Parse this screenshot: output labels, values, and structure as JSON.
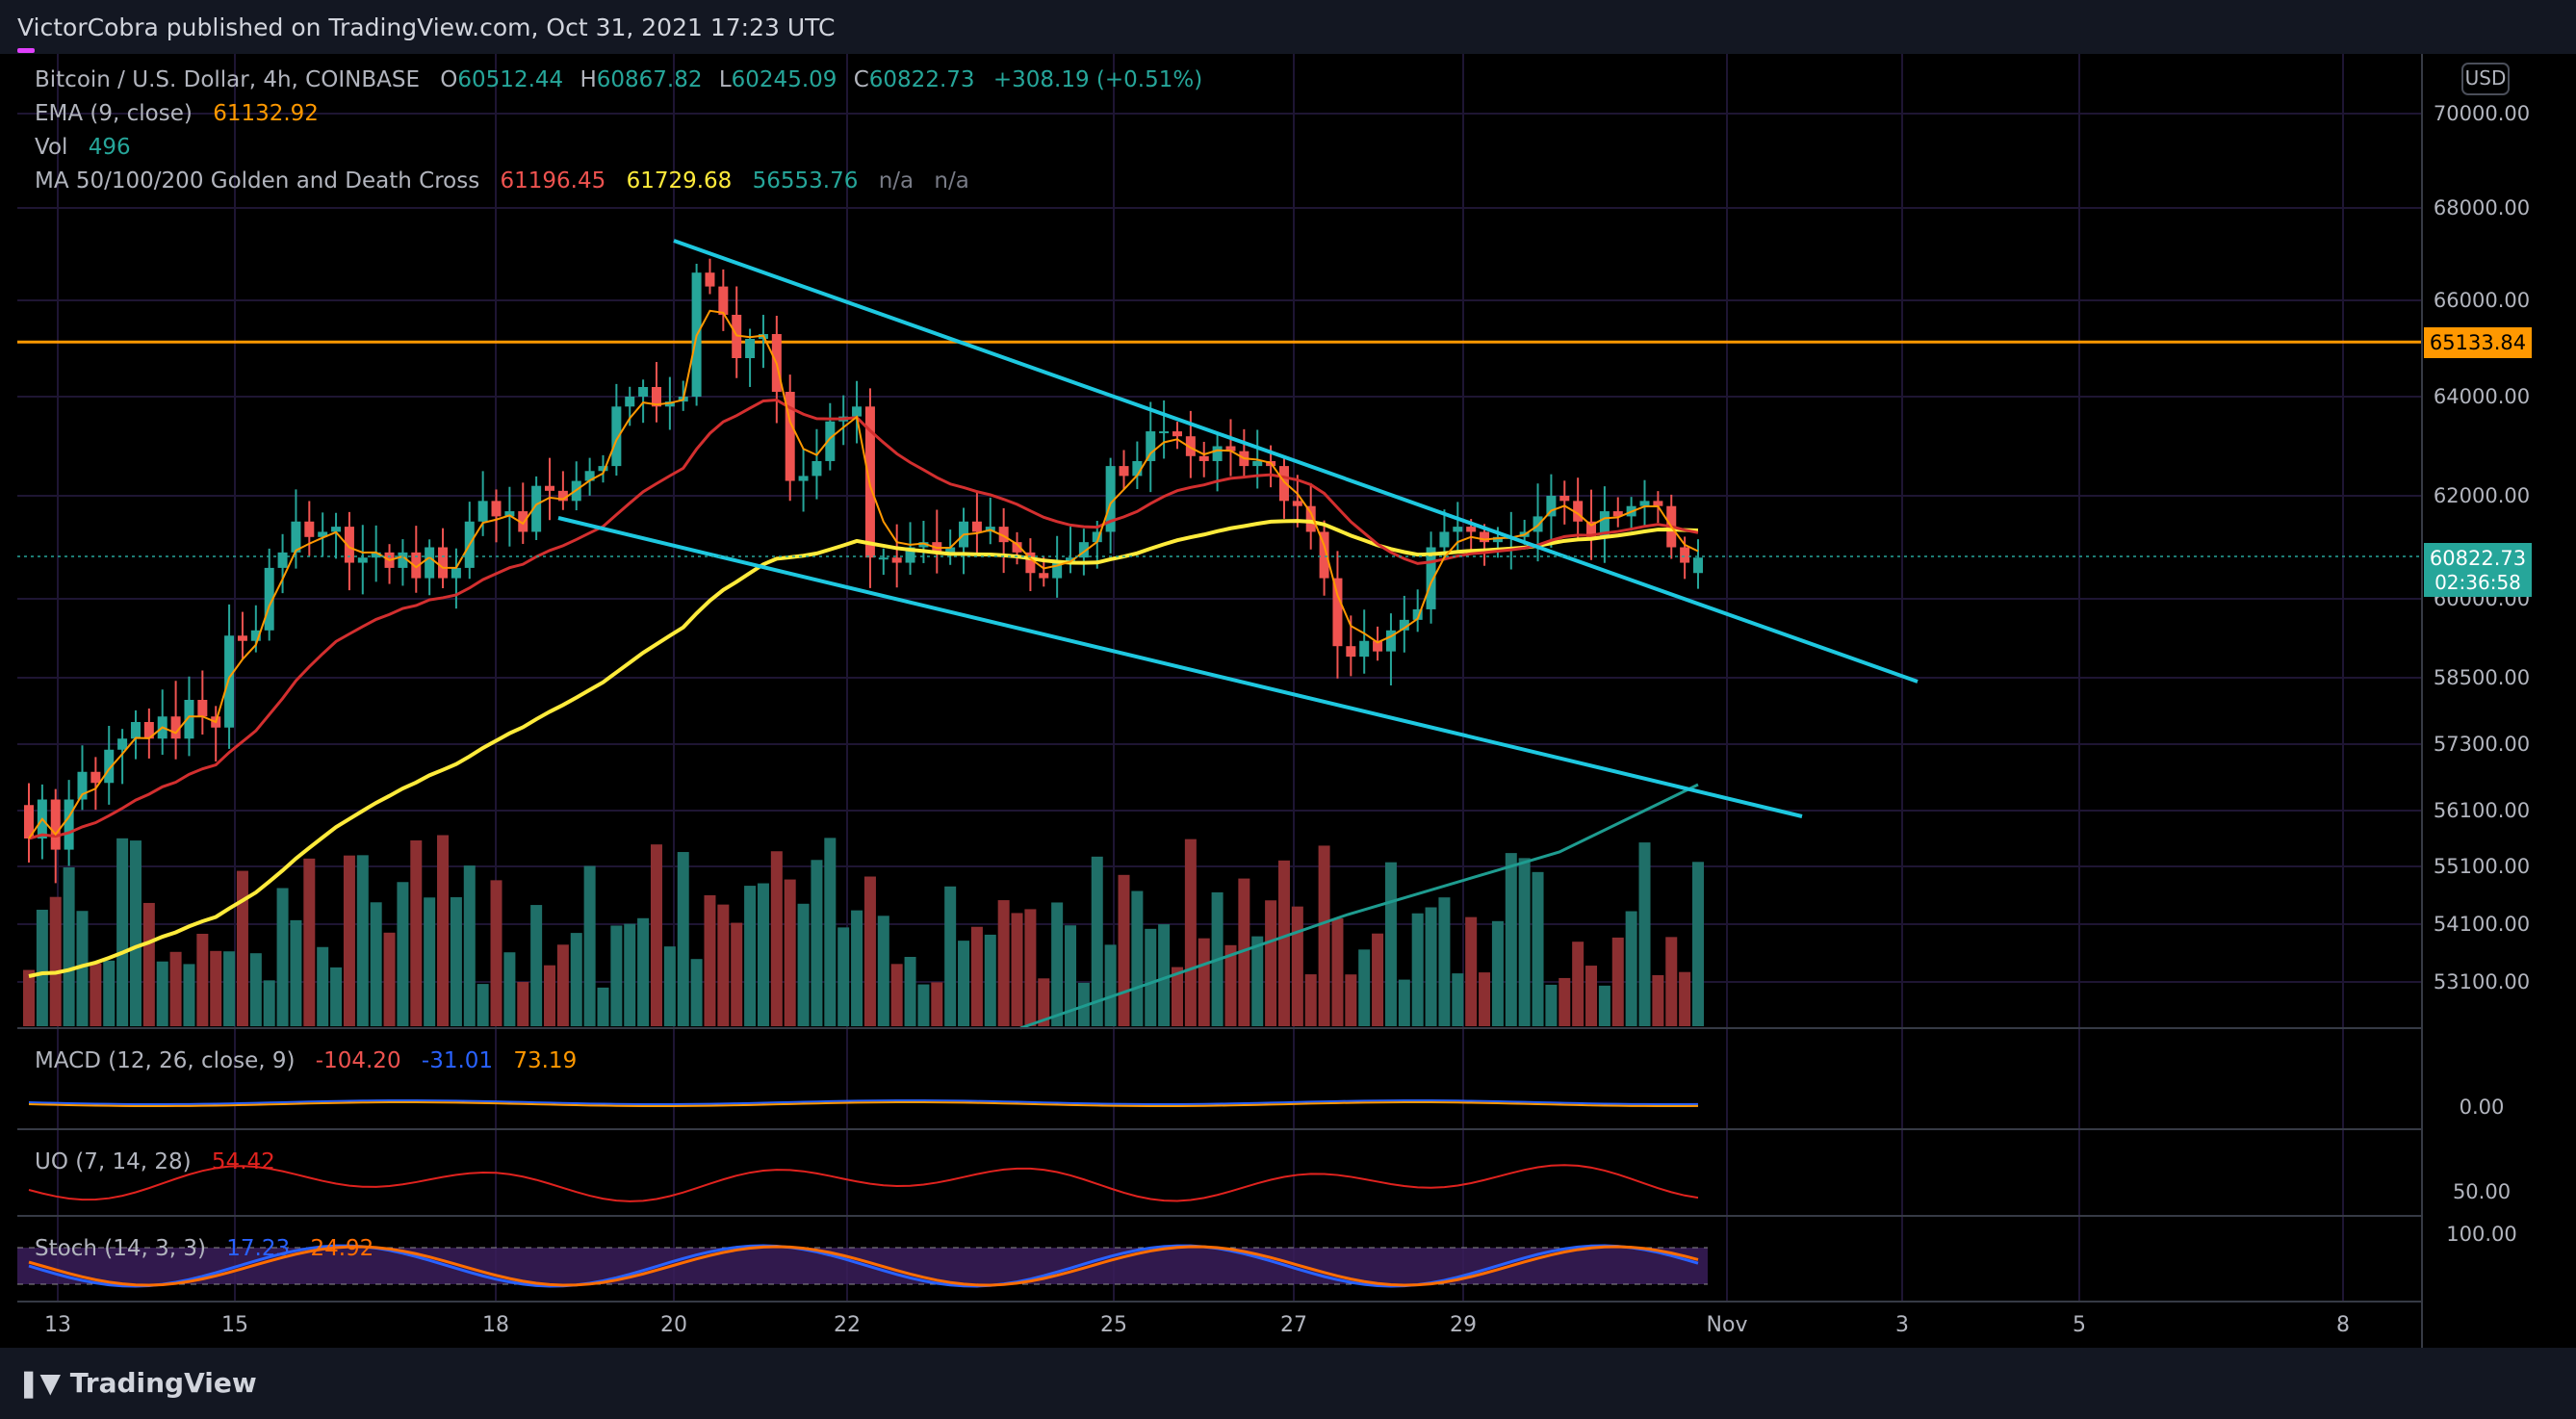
{
  "header": {
    "publisher": "VictorCobra published on TradingView.com, Oct 31, 2021 17:23 UTC"
  },
  "legend": {
    "symbol": "Bitcoin / U.S. Dollar, 4h, COINBASE",
    "o_label": "O",
    "o_value": "60512.44",
    "h_label": "H",
    "h_value": "60867.82",
    "l_label": "L",
    "l_value": "60245.09",
    "c_label": "C",
    "c_value": "60822.73",
    "change": "+308.19 (+0.51%)",
    "ema_label": "EMA (9, close)",
    "ema_value": "61132.92",
    "vol_label": "Vol",
    "vol_value": "496",
    "ma_label": "MA 50/100/200 Golden and Death Cross",
    "ma50_value": "61196.45",
    "ma100_value": "61729.68",
    "ma200_value": "56553.76",
    "na1": "n/a",
    "na2": "n/a"
  },
  "macd": {
    "label": "MACD (12, 26, close, 9)",
    "v1": "-104.20",
    "v2": "-31.01",
    "v3": "73.19"
  },
  "uo": {
    "label": "UO (7, 14, 28)",
    "v1": "54.42"
  },
  "stoch": {
    "label": "Stoch (14, 3, 3)",
    "v1": "17.23",
    "v2": "24.92"
  },
  "currency": "USD",
  "price_scale": [
    "70000.00",
    "68000.00",
    "66000.00",
    "64000.00",
    "62000.00",
    "60000.00",
    "58500.00",
    "57300.00",
    "56100.00",
    "55100.00",
    "54100.00",
    "53100.00"
  ],
  "macd_scale": [
    "0.00"
  ],
  "uo_scale": [
    "50.00"
  ],
  "stoch_scale": [
    "100.00"
  ],
  "hline_label": "65133.84",
  "last_price": {
    "price": "60822.73",
    "countdown": "02:36:58"
  },
  "x_axis": [
    "13",
    "15",
    "18",
    "20",
    "22",
    "25",
    "27",
    "29",
    "Nov",
    "3",
    "5",
    "8"
  ],
  "footer": {
    "brand": "TradingView"
  },
  "colors": {
    "background": "#131722",
    "up": "#26a69a",
    "down": "#ef5350",
    "ema": "#ff9800",
    "ma50": "#d32f2f",
    "ma100": "#ffeb3b",
    "ma200": "#1e9c90",
    "trendline": "#1ec8e0",
    "hline": "#ff9800",
    "grid": "#2a1f4e"
  },
  "chart_data": {
    "type": "candlestick",
    "title": "Bitcoin / U.S. Dollar, 4h, COINBASE",
    "ylim": [
      52300,
      71000
    ],
    "x": [
      "13",
      "15",
      "18",
      "20",
      "22",
      "25",
      "27",
      "29",
      "Nov",
      "3",
      "5",
      "8"
    ],
    "horizontal_line": 65133.84,
    "close": [
      55600,
      56300,
      55400,
      56300,
      56800,
      56600,
      57200,
      57400,
      57700,
      57400,
      57800,
      57400,
      58100,
      57800,
      57600,
      59300,
      59200,
      59400,
      60600,
      60900,
      61500,
      61200,
      61300,
      61400,
      60700,
      60800,
      60900,
      60600,
      60900,
      60400,
      61000,
      60400,
      60600,
      61500,
      61900,
      61600,
      61700,
      61300,
      62200,
      62100,
      61900,
      62300,
      62500,
      62600,
      63800,
      64000,
      64200,
      63800,
      63900,
      64000,
      66600,
      66300,
      65700,
      64800,
      65200,
      65300,
      64100,
      62300,
      62400,
      62700,
      63500,
      63600,
      63800,
      60800,
      60800,
      60700,
      61000,
      61100,
      60900,
      61000,
      61500,
      61300,
      61400,
      61100,
      60900,
      60500,
      60400,
      60700,
      60800,
      61100,
      61300,
      62600,
      62400,
      62700,
      63300,
      63300,
      63200,
      62800,
      62700,
      63000,
      62900,
      62600,
      62700,
      62600,
      61900,
      61800,
      61300,
      60400,
      59100,
      58900,
      59200,
      59000,
      59400,
      59600,
      59800,
      61000,
      61300,
      61400,
      61300,
      61100,
      61200,
      61200,
      61300,
      61600,
      62000,
      61900,
      61500,
      61200,
      61700,
      61600,
      61800,
      61900,
      61800,
      61000,
      60700,
      60800
    ],
    "open": [
      56200,
      55600,
      56300,
      55400,
      56300,
      56800,
      56600,
      57200,
      57400,
      57700,
      57400,
      57800,
      57400,
      58100,
      57800,
      57600,
      59300,
      59200,
      59400,
      60600,
      60900,
      61500,
      61200,
      61300,
      61400,
      60700,
      60800,
      60900,
      60600,
      60900,
      60400,
      61000,
      60400,
      60600,
      61500,
      61900,
      61600,
      61700,
      61300,
      62200,
      62100,
      61900,
      62300,
      62500,
      62600,
      63800,
      64000,
      64200,
      63800,
      63900,
      64000,
      66600,
      66300,
      65700,
      64800,
      65200,
      65300,
      64100,
      62300,
      62400,
      62700,
      63500,
      63600,
      63800,
      60800,
      60800,
      60700,
      61000,
      61100,
      60900,
      61000,
      61500,
      61300,
      61400,
      61100,
      60900,
      60500,
      60400,
      60700,
      60800,
      61100,
      61300,
      62600,
      62400,
      62700,
      63300,
      63300,
      63200,
      62800,
      62700,
      63000,
      62900,
      62600,
      62700,
      62600,
      61900,
      61800,
      61300,
      60400,
      59100,
      58900,
      59200,
      59000,
      59400,
      59600,
      59800,
      61000,
      61300,
      61400,
      61300,
      61100,
      61200,
      61200,
      61300,
      61600,
      62000,
      61900,
      61500,
      61200,
      61700,
      61600,
      61800,
      61900,
      61800,
      61000,
      60500
    ],
    "series": [
      {
        "name": "EMA (9, close)",
        "last": 61132.92
      },
      {
        "name": "MA 50",
        "last": 61196.45
      },
      {
        "name": "MA 100",
        "last": 61729.68
      },
      {
        "name": "MA 200",
        "last": 56553.76
      }
    ]
  }
}
